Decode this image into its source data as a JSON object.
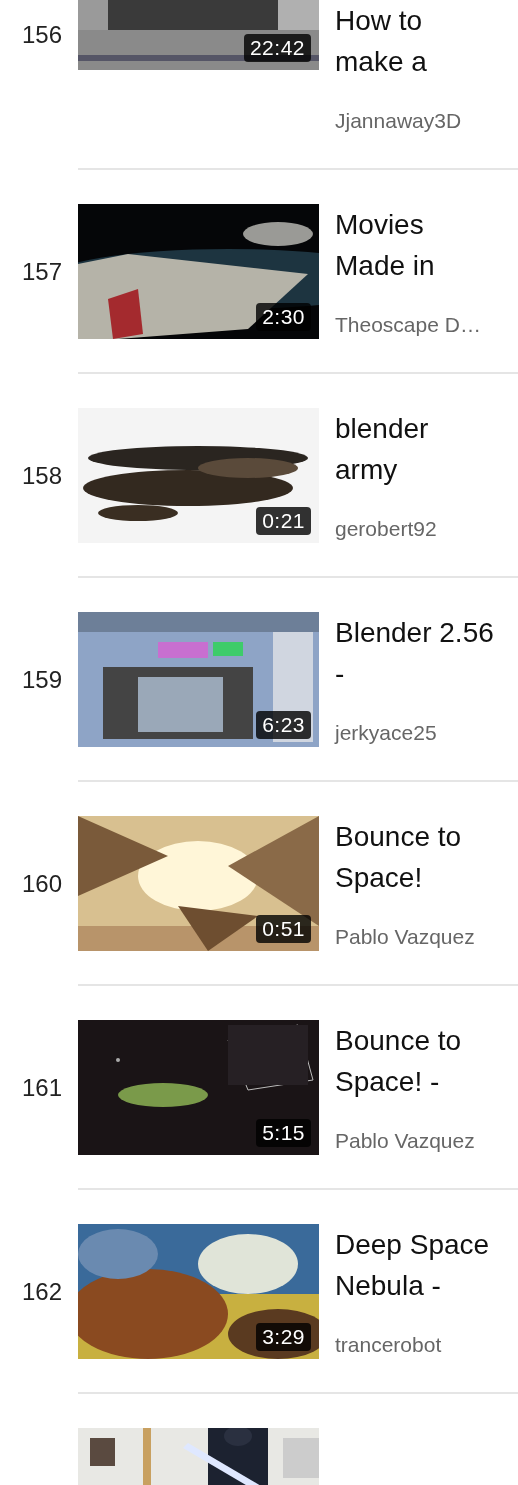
{
  "videos": [
    {
      "index": "156",
      "title": "How to\nmake a",
      "channel": "Jjannaway3D",
      "duration": "22:42",
      "thumbnail": {
        "kind": "picture"
      }
    },
    {
      "index": "157",
      "title": "Movies\nMade in",
      "channel": "Theoscape D…",
      "duration": "2:30",
      "thumbnail": {
        "kind": "picture"
      }
    },
    {
      "index": "158",
      "title": "blender\narmy",
      "channel": "gerobert92",
      "duration": "0:21",
      "thumbnail": {
        "kind": "picture"
      }
    },
    {
      "index": "159",
      "title": "Blender 2.56\n-",
      "channel": "jerkyace25",
      "duration": "6:23",
      "thumbnail": {
        "kind": "picture"
      }
    },
    {
      "index": "160",
      "title": "Bounce to\nSpace!",
      "channel": "Pablo Vazquez",
      "duration": "0:51",
      "thumbnail": {
        "kind": "picture"
      }
    },
    {
      "index": "161",
      "title": "Bounce to\nSpace! -",
      "channel": "Pablo Vazquez",
      "duration": "5:15",
      "thumbnail": {
        "kind": "picture"
      }
    },
    {
      "index": "162",
      "title": "Deep Space\nNebula -",
      "channel": "trancerobot",
      "duration": "3:29",
      "thumbnail": {
        "kind": "picture"
      }
    },
    {
      "thumbnail": {
        "kind": "picture"
      }
    }
  ]
}
